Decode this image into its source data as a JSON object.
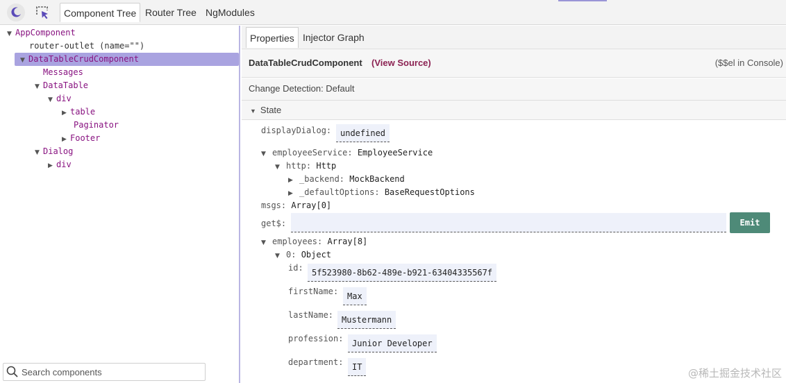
{
  "toolbar": {
    "tabs": [
      "Component Tree",
      "Router Tree",
      "NgModules"
    ]
  },
  "tree": {
    "items": [
      {
        "label": "AppComponent",
        "expander": "▼"
      },
      {
        "label": "router-outlet (name=\"\")",
        "expander": ""
      },
      {
        "label": "DataTableCrudComponent",
        "expander": "▼"
      },
      {
        "label": "Messages",
        "expander": ""
      },
      {
        "label": "DataTable",
        "expander": "▼"
      },
      {
        "label": "div",
        "expander": "▼"
      },
      {
        "label": "table",
        "expander": "▶"
      },
      {
        "label": "Paginator",
        "expander": ""
      },
      {
        "label": "Footer",
        "expander": "▶"
      },
      {
        "label": "Dialog",
        "expander": "▼"
      },
      {
        "label": "div",
        "expander": "▶"
      }
    ]
  },
  "search": {
    "placeholder": "Search components"
  },
  "details": {
    "tabs": [
      "Properties",
      "Injector Graph"
    ],
    "component_name": "DataTableCrudComponent",
    "view_source": "(View Source)",
    "console_hint": "($$el in Console)",
    "change_detection": "Change Detection: Default",
    "state_label": "State",
    "emit_label": "Emit"
  },
  "state": {
    "displayDialog": {
      "key": "displayDialog:",
      "value": "undefined"
    },
    "employeeService": {
      "key": "employeeService:",
      "value": "EmployeeService"
    },
    "http": {
      "key": "http:",
      "value": "Http"
    },
    "backend": {
      "key": "_backend:",
      "value": "MockBackend"
    },
    "defaultOptions": {
      "key": "_defaultOptions:",
      "value": "BaseRequestOptions"
    },
    "msgs": {
      "key": "msgs:",
      "value": "Array[0]"
    },
    "get": {
      "key": "get$:",
      "value": ""
    },
    "employees": {
      "key": "employees:",
      "value": "Array[8]"
    },
    "item0": {
      "key": "0:",
      "value": "Object"
    },
    "id": {
      "key": "id:",
      "value": "5f523980-8b62-489e-b921-63404335567f"
    },
    "firstName": {
      "key": "firstName:",
      "value": "Max"
    },
    "lastName": {
      "key": "lastName:",
      "value": "Mustermann"
    },
    "profession": {
      "key": "profession:",
      "value": "Junior Developer"
    },
    "department": {
      "key": "department:",
      "value": "IT"
    }
  },
  "watermark": "@稀土掘金技术社区",
  "colors": {
    "selected": "#a9a3e0",
    "emit": "#4e8a78",
    "component_name": "#881280"
  },
  "icons": [
    "moon-icon",
    "inspect-icon",
    "search-icon"
  ]
}
